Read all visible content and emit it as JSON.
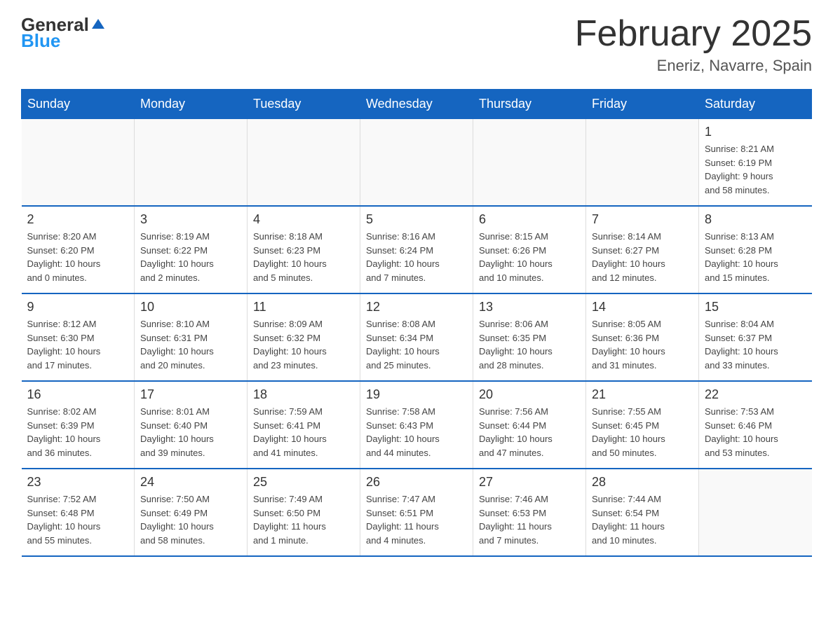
{
  "header": {
    "logo_general": "General",
    "logo_blue": "Blue",
    "title": "February 2025",
    "subtitle": "Eneriz, Navarre, Spain"
  },
  "weekdays": [
    "Sunday",
    "Monday",
    "Tuesday",
    "Wednesday",
    "Thursday",
    "Friday",
    "Saturday"
  ],
  "weeks": [
    {
      "days": [
        {
          "number": "",
          "info": ""
        },
        {
          "number": "",
          "info": ""
        },
        {
          "number": "",
          "info": ""
        },
        {
          "number": "",
          "info": ""
        },
        {
          "number": "",
          "info": ""
        },
        {
          "number": "",
          "info": ""
        },
        {
          "number": "1",
          "info": "Sunrise: 8:21 AM\nSunset: 6:19 PM\nDaylight: 9 hours\nand 58 minutes."
        }
      ]
    },
    {
      "days": [
        {
          "number": "2",
          "info": "Sunrise: 8:20 AM\nSunset: 6:20 PM\nDaylight: 10 hours\nand 0 minutes."
        },
        {
          "number": "3",
          "info": "Sunrise: 8:19 AM\nSunset: 6:22 PM\nDaylight: 10 hours\nand 2 minutes."
        },
        {
          "number": "4",
          "info": "Sunrise: 8:18 AM\nSunset: 6:23 PM\nDaylight: 10 hours\nand 5 minutes."
        },
        {
          "number": "5",
          "info": "Sunrise: 8:16 AM\nSunset: 6:24 PM\nDaylight: 10 hours\nand 7 minutes."
        },
        {
          "number": "6",
          "info": "Sunrise: 8:15 AM\nSunset: 6:26 PM\nDaylight: 10 hours\nand 10 minutes."
        },
        {
          "number": "7",
          "info": "Sunrise: 8:14 AM\nSunset: 6:27 PM\nDaylight: 10 hours\nand 12 minutes."
        },
        {
          "number": "8",
          "info": "Sunrise: 8:13 AM\nSunset: 6:28 PM\nDaylight: 10 hours\nand 15 minutes."
        }
      ]
    },
    {
      "days": [
        {
          "number": "9",
          "info": "Sunrise: 8:12 AM\nSunset: 6:30 PM\nDaylight: 10 hours\nand 17 minutes."
        },
        {
          "number": "10",
          "info": "Sunrise: 8:10 AM\nSunset: 6:31 PM\nDaylight: 10 hours\nand 20 minutes."
        },
        {
          "number": "11",
          "info": "Sunrise: 8:09 AM\nSunset: 6:32 PM\nDaylight: 10 hours\nand 23 minutes."
        },
        {
          "number": "12",
          "info": "Sunrise: 8:08 AM\nSunset: 6:34 PM\nDaylight: 10 hours\nand 25 minutes."
        },
        {
          "number": "13",
          "info": "Sunrise: 8:06 AM\nSunset: 6:35 PM\nDaylight: 10 hours\nand 28 minutes."
        },
        {
          "number": "14",
          "info": "Sunrise: 8:05 AM\nSunset: 6:36 PM\nDaylight: 10 hours\nand 31 minutes."
        },
        {
          "number": "15",
          "info": "Sunrise: 8:04 AM\nSunset: 6:37 PM\nDaylight: 10 hours\nand 33 minutes."
        }
      ]
    },
    {
      "days": [
        {
          "number": "16",
          "info": "Sunrise: 8:02 AM\nSunset: 6:39 PM\nDaylight: 10 hours\nand 36 minutes."
        },
        {
          "number": "17",
          "info": "Sunrise: 8:01 AM\nSunset: 6:40 PM\nDaylight: 10 hours\nand 39 minutes."
        },
        {
          "number": "18",
          "info": "Sunrise: 7:59 AM\nSunset: 6:41 PM\nDaylight: 10 hours\nand 41 minutes."
        },
        {
          "number": "19",
          "info": "Sunrise: 7:58 AM\nSunset: 6:43 PM\nDaylight: 10 hours\nand 44 minutes."
        },
        {
          "number": "20",
          "info": "Sunrise: 7:56 AM\nSunset: 6:44 PM\nDaylight: 10 hours\nand 47 minutes."
        },
        {
          "number": "21",
          "info": "Sunrise: 7:55 AM\nSunset: 6:45 PM\nDaylight: 10 hours\nand 50 minutes."
        },
        {
          "number": "22",
          "info": "Sunrise: 7:53 AM\nSunset: 6:46 PM\nDaylight: 10 hours\nand 53 minutes."
        }
      ]
    },
    {
      "days": [
        {
          "number": "23",
          "info": "Sunrise: 7:52 AM\nSunset: 6:48 PM\nDaylight: 10 hours\nand 55 minutes."
        },
        {
          "number": "24",
          "info": "Sunrise: 7:50 AM\nSunset: 6:49 PM\nDaylight: 10 hours\nand 58 minutes."
        },
        {
          "number": "25",
          "info": "Sunrise: 7:49 AM\nSunset: 6:50 PM\nDaylight: 11 hours\nand 1 minute."
        },
        {
          "number": "26",
          "info": "Sunrise: 7:47 AM\nSunset: 6:51 PM\nDaylight: 11 hours\nand 4 minutes."
        },
        {
          "number": "27",
          "info": "Sunrise: 7:46 AM\nSunset: 6:53 PM\nDaylight: 11 hours\nand 7 minutes."
        },
        {
          "number": "28",
          "info": "Sunrise: 7:44 AM\nSunset: 6:54 PM\nDaylight: 11 hours\nand 10 minutes."
        },
        {
          "number": "",
          "info": ""
        }
      ]
    }
  ]
}
